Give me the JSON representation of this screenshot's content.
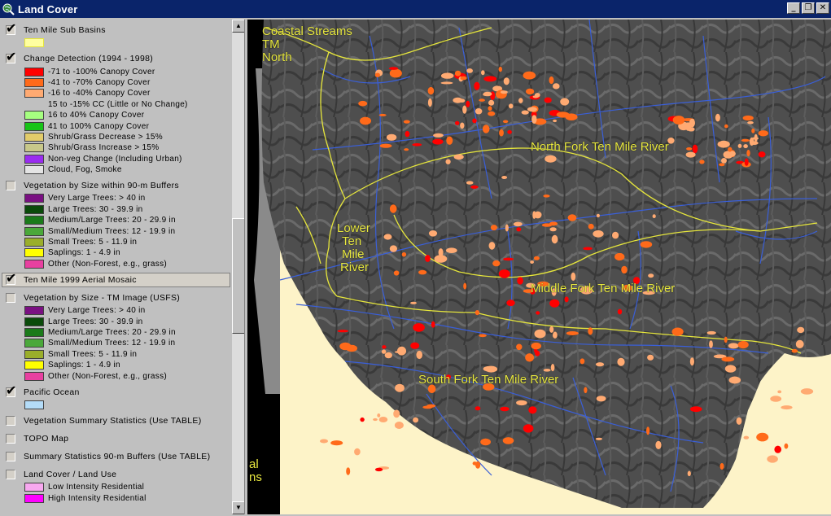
{
  "window": {
    "title": "Land Cover",
    "minimize": "_",
    "restore": "❐",
    "close": "✕"
  },
  "colors": {
    "titlebar": "#0a246a",
    "ocean": "#fdf3c8",
    "basin_line": "#e6e63c",
    "streams": "#3a5fd8",
    "label": "#e8e840"
  },
  "toc": {
    "layers": [
      {
        "name": "Ten Mile Sub Basins",
        "checked": true,
        "legend": [
          {
            "label": "",
            "color": "#ffffa0",
            "outline": "#e6e63c"
          }
        ]
      },
      {
        "name": "Change Detection (1994 - 1998)",
        "checked": true,
        "legend": [
          {
            "label": "-71 to -100% Canopy Cover",
            "color": "#ff0000"
          },
          {
            "label": "-41 to -70% Canopy Cover",
            "color": "#ff6a1a"
          },
          {
            "label": "-16 to -40% Canopy Cover",
            "color": "#ffaa72"
          },
          {
            "label": "15 to -15% CC (Little or No Change)",
            "color": ""
          },
          {
            "label": "16 to 40% Canopy Cover",
            "color": "#a6ff80"
          },
          {
            "label": "41 to 100% Canopy Cover",
            "color": "#18c418"
          },
          {
            "label": "Shrub/Grass Decrease > 15%",
            "color": "#e2cc6a"
          },
          {
            "label": "Shrub/Grass Increase > 15%",
            "color": "#c8c88a"
          },
          {
            "label": "Non-veg Change (Including Urban)",
            "color": "#9a2cf0"
          },
          {
            "label": "Cloud, Fog, Smoke",
            "color": "#e4e4e4"
          }
        ]
      },
      {
        "name": "Vegetation by Size within 90-m Buffers",
        "checked": false,
        "legend": [
          {
            "label": "Very Large Trees: > 40  in",
            "color": "#7a1082"
          },
          {
            "label": "Large Trees: 30 - 39.9 in",
            "color": "#0a4a0a"
          },
          {
            "label": "Medium/Large Trees: 20 - 29.9 in",
            "color": "#1a7a1a"
          },
          {
            "label": "Small/Medium Trees: 12 - 19.9 in",
            "color": "#4aa83a"
          },
          {
            "label": "Small Trees: 5 - 11.9 in",
            "color": "#9aae2a"
          },
          {
            "label": "Saplings: 1 - 4.9 in",
            "color": "#ffff00"
          },
          {
            "label": "Other (Non-Forest, e.g., grass)",
            "color": "#e840a0"
          }
        ]
      },
      {
        "name": "Ten Mile 1999 Aerial Mosaic",
        "checked": true,
        "selected": true,
        "legend": []
      },
      {
        "name": "Vegetation by Size - TM Image (USFS)",
        "checked": false,
        "legend": [
          {
            "label": "Very Large Trees: > 40  in",
            "color": "#7a1082"
          },
          {
            "label": "Large Trees: 30 - 39.9 in",
            "color": "#0a4a0a"
          },
          {
            "label": "Medium/Large Trees: 20 - 29.9 in",
            "color": "#1a7a1a"
          },
          {
            "label": "Small/Medium Trees: 12 - 19.9 in",
            "color": "#4aa83a"
          },
          {
            "label": "Small Trees: 5 - 11.9 in",
            "color": "#9aae2a"
          },
          {
            "label": "Saplings: 1 - 4.9 in",
            "color": "#ffff00"
          },
          {
            "label": "Other (Non-Forest, e.g., grass)",
            "color": "#e840a0"
          }
        ]
      },
      {
        "name": "Pacific Ocean",
        "checked": true,
        "legend": [
          {
            "label": "",
            "color": "#b4dcf8"
          }
        ]
      },
      {
        "name": "Vegetation Summary Statistics (Use TABLE)",
        "checked": false,
        "legend": []
      },
      {
        "name": "TOPO Map",
        "checked": false,
        "legend": []
      },
      {
        "name": "Summary Statistics 90-m Buffers (Use TABLE)",
        "checked": false,
        "legend": []
      },
      {
        "name": "Land Cover / Land Use",
        "checked": false,
        "legend": [
          {
            "label": "Low Intensity Residential",
            "color": "#f8a8f0"
          },
          {
            "label": "High Intensity Residential",
            "color": "#ff00ff"
          }
        ]
      }
    ]
  },
  "map": {
    "labels": {
      "coastal_streams": "Coastal Streams",
      "tm": "TM",
      "north": "North",
      "north_fork": "North Fork Ten Mile River",
      "lower": "Lower",
      "ten": "Ten",
      "mile": "Mile",
      "river": "River",
      "middle_fork": "Middle Fork Ten Mile River",
      "south_fork": "South Fork Ten Mile River",
      "edge_al": "al",
      "edge_ns": "ns"
    }
  }
}
